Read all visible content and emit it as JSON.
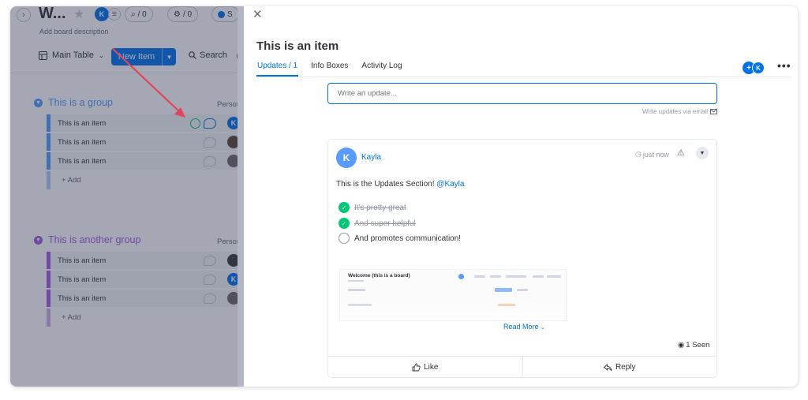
{
  "colors": {
    "accent": "#0073ea",
    "group1": "#579bfc",
    "group2": "#a25ddc",
    "done": "#00c875",
    "arrow": "#e2445c"
  },
  "board": {
    "title": "W...",
    "description": "Add board description",
    "star_icon": "star-icon",
    "owner_initial": "K",
    "stat_1": "/ 0",
    "stat_2": "/ 0",
    "stat_3": "S",
    "view_label": "Main Table",
    "new_item_label": "New Item",
    "search_label": "Search",
    "groups": [
      {
        "title": "This is a group",
        "column_person": "Person",
        "rows": [
          {
            "name": "This is an item",
            "person_initial": "K"
          },
          {
            "name": "This is an item",
            "person_initial": ""
          },
          {
            "name": "This is an item",
            "person_initial": ""
          }
        ],
        "add_label": "+ Add"
      },
      {
        "title": "This is another group",
        "column_person": "Person",
        "rows": [
          {
            "name": "This is an item",
            "person_initial": ""
          },
          {
            "name": "This is an item",
            "person_initial": "K"
          },
          {
            "name": "This is an item",
            "person_initial": ""
          }
        ],
        "add_label": "+ Add"
      }
    ]
  },
  "panel": {
    "close_icon": "close-icon",
    "item_title": "This is an item",
    "tabs": [
      {
        "label": "Updates / 1",
        "active": true
      },
      {
        "label": "Info Boxes",
        "active": false
      },
      {
        "label": "Activity Log",
        "active": false
      }
    ],
    "subscriber_initial": "K",
    "update_placeholder": "Write an update...",
    "email_hint": "Write updates via email",
    "post": {
      "author_initial": "K",
      "author": "Kayla",
      "time": "just now",
      "body_text": "This is the Updates Section!",
      "mention": "@Kayla",
      "checklist": [
        {
          "text": "It's pretty great",
          "done": true
        },
        {
          "text": "And super helpful",
          "done": true
        },
        {
          "text": "And promotes communication!",
          "done": false
        }
      ],
      "thumbnail_title": "Welcome (this is a board)",
      "read_more": "Read More",
      "seen": "1 Seen",
      "like_label": "Like",
      "reply_label": "Reply"
    }
  }
}
